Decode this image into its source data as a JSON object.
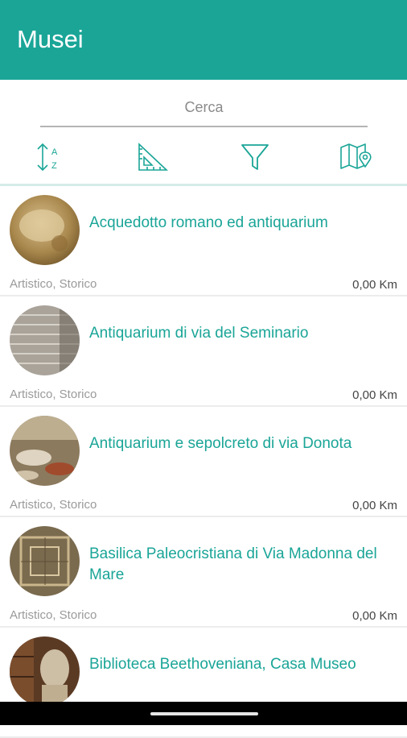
{
  "header": {
    "title": "Musei"
  },
  "search": {
    "placeholder": "Cerca"
  },
  "toolbar": {
    "colors": {
      "accent": "#1aa597"
    },
    "icons": [
      "sort-az-icon",
      "ruler-triangle-icon",
      "filter-icon",
      "map-pin-icon"
    ]
  },
  "museums": [
    {
      "title": "Acquedotto romano ed antiquarium",
      "category": "Artistico, Storico",
      "distance": "0,00 Km"
    },
    {
      "title": "Antiquarium di via del Seminario",
      "category": "Artistico, Storico",
      "distance": "0,00 Km"
    },
    {
      "title": "Antiquarium e sepolcreto di via Donota",
      "category": "Artistico, Storico",
      "distance": "0,00 Km"
    },
    {
      "title": "Basilica Paleocristiana di Via Madonna del Mare",
      "category": "Artistico, Storico",
      "distance": "0,00 Km"
    },
    {
      "title": "Biblioteca Beethoveniana, Casa Museo",
      "category": "",
      "distance": ""
    }
  ]
}
